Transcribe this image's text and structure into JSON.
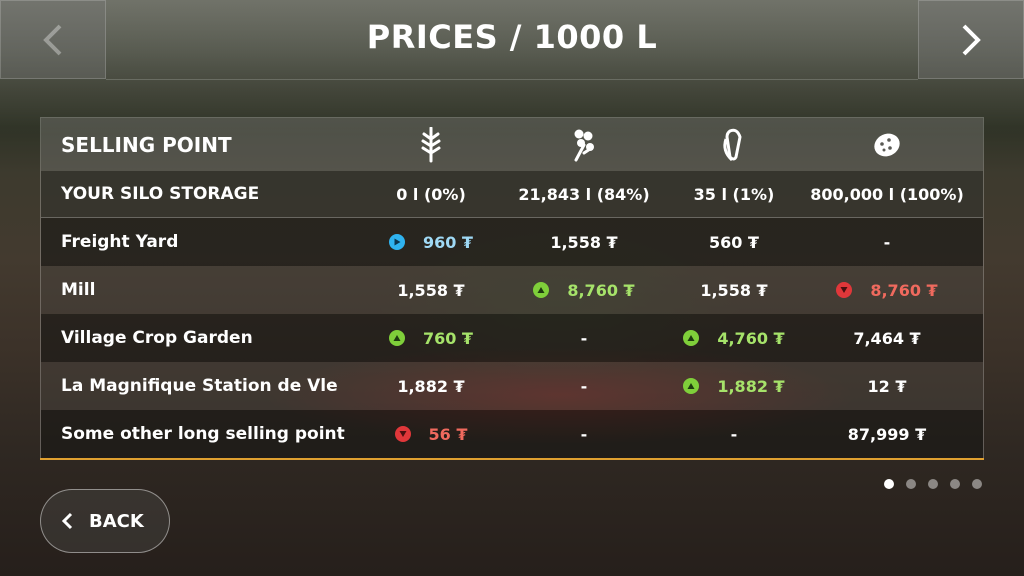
{
  "header": {
    "title": "PRICES / 1000 L"
  },
  "table": {
    "header_label": "SELLING POINT",
    "crop_icons": [
      "wheat-icon",
      "canola-icon",
      "corn-icon",
      "potato-icon"
    ],
    "silo": {
      "label": "YOUR SILO STORAGE",
      "values": [
        "0 l (0%)",
        "21,843 l (84%)",
        "35 l (1%)",
        "800,000 l (100%)"
      ]
    },
    "rows": [
      {
        "name": "Freight Yard",
        "cells": [
          {
            "value": "960 ₮",
            "trend": "play"
          },
          {
            "value": "1,558 ₮",
            "trend": "none"
          },
          {
            "value": "560 ₮",
            "trend": "none"
          },
          {
            "value": "-",
            "trend": "none"
          }
        ]
      },
      {
        "name": "Mill",
        "cells": [
          {
            "value": "1,558 ₮",
            "trend": "none"
          },
          {
            "value": "8,760 ₮",
            "trend": "up"
          },
          {
            "value": "1,558 ₮",
            "trend": "none"
          },
          {
            "value": "8,760 ₮",
            "trend": "down"
          }
        ]
      },
      {
        "name": "Village Crop Garden",
        "cells": [
          {
            "value": "760 ₮",
            "trend": "up"
          },
          {
            "value": "-",
            "trend": "none"
          },
          {
            "value": "4,760 ₮",
            "trend": "up"
          },
          {
            "value": "7,464 ₮",
            "trend": "none"
          }
        ]
      },
      {
        "name": "La Magnifique Station de Vle",
        "cells": [
          {
            "value": "1,882 ₮",
            "trend": "none"
          },
          {
            "value": "-",
            "trend": "none"
          },
          {
            "value": "1,882 ₮",
            "trend": "up"
          },
          {
            "value": "12 ₮",
            "trend": "none"
          }
        ]
      },
      {
        "name": "Some other long selling point",
        "cells": [
          {
            "value": "56 ₮",
            "trend": "down"
          },
          {
            "value": "-",
            "trend": "none"
          },
          {
            "value": "-",
            "trend": "none"
          },
          {
            "value": "87,999 ₮",
            "trend": "none"
          }
        ]
      }
    ]
  },
  "colors": {
    "up": "#7fcf3a",
    "down": "#e0373a",
    "play": "#2fb3f0",
    "accent_line": "#e0a030"
  },
  "pagination": {
    "pages": 5,
    "current": 1
  },
  "footer": {
    "back_label": "BACK"
  }
}
